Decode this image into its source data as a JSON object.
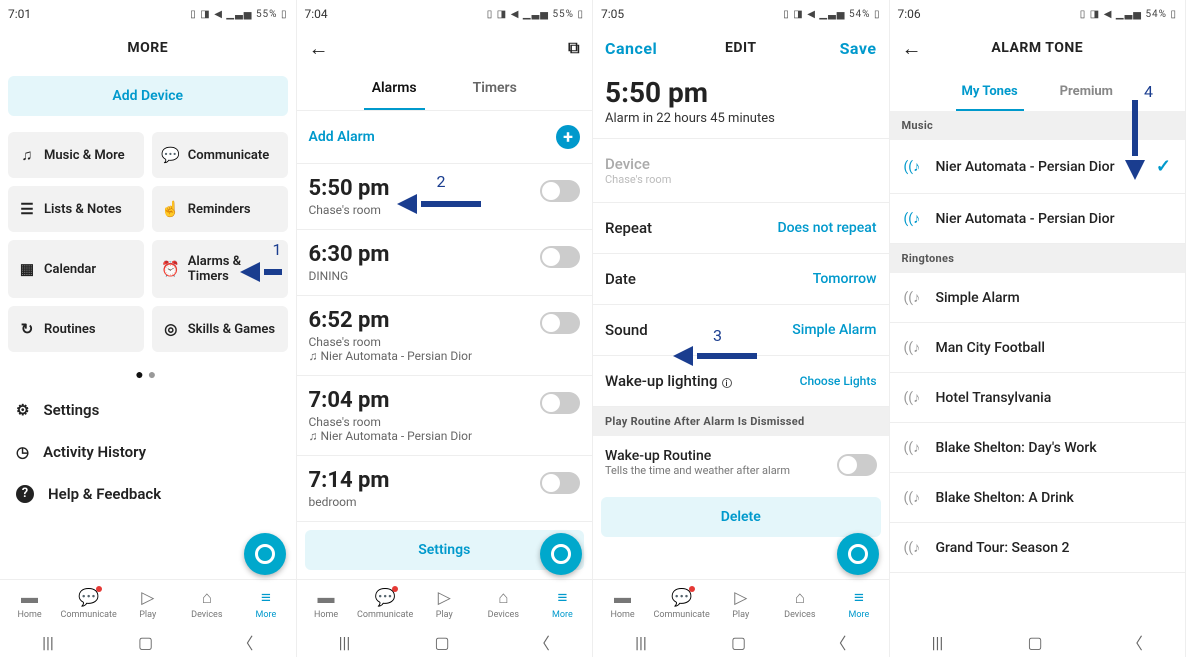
{
  "screen1": {
    "status_time": "7:01",
    "status_right": "55%",
    "title": "MORE",
    "add_device": "Add Device",
    "tiles": [
      {
        "icon": "♫",
        "label": "Music & More"
      },
      {
        "icon": "💬",
        "label": "Communicate"
      },
      {
        "icon": "☰",
        "label": "Lists & Notes"
      },
      {
        "icon": "☝",
        "label": "Reminders"
      },
      {
        "icon": "▦",
        "label": "Calendar"
      },
      {
        "icon": "⏰",
        "label": "Alarms & Timers"
      },
      {
        "icon": "↻",
        "label": "Routines"
      },
      {
        "icon": "◎",
        "label": "Skills & Games"
      }
    ],
    "rows": [
      {
        "icon": "⚙",
        "label": "Settings"
      },
      {
        "icon": "◷",
        "label": "Activity History"
      },
      {
        "icon": "?",
        "label": "Help & Feedback"
      }
    ]
  },
  "screen2": {
    "status_time": "7:04",
    "status_right": "55%",
    "tabs": {
      "alarms": "Alarms",
      "timers": "Timers"
    },
    "add_alarm": "Add Alarm",
    "alarms": [
      {
        "time": "5:50 pm",
        "room": "Chase's room",
        "music": null
      },
      {
        "time": "6:30 pm",
        "room": "DINING",
        "music": null
      },
      {
        "time": "6:52 pm",
        "room": "Chase's room",
        "music": "Nier Automata - Persian Dior"
      },
      {
        "time": "7:04 pm",
        "room": "Chase's room",
        "music": "Nier Automata - Persian Dior"
      },
      {
        "time": "7:14 pm",
        "room": "bedroom",
        "music": null
      }
    ],
    "settings": "Settings"
  },
  "screen3": {
    "status_time": "7:05",
    "status_right": "54%",
    "cancel": "Cancel",
    "title": "EDIT",
    "save": "Save",
    "bigtime": "5:50 pm",
    "alarmin": "Alarm in 22 hours 45 minutes",
    "device_label": "Device",
    "device_value": "Chase's room",
    "repeat_label": "Repeat",
    "repeat_value": "Does not repeat",
    "date_label": "Date",
    "date_value": "Tomorrow",
    "sound_label": "Sound",
    "sound_value": "Simple Alarm",
    "wake_label": "Wake-up lighting",
    "wake_value": "Choose Lights",
    "section": "Play Routine After Alarm Is Dismissed",
    "routine_t1": "Wake-up Routine",
    "routine_t2": "Tells the time and weather after alarm",
    "delete": "Delete"
  },
  "screen4": {
    "status_time": "7:06",
    "status_right": "54%",
    "title": "ALARM TONE",
    "tabs": {
      "my": "My Tones",
      "premium": "Premium"
    },
    "section_music": "Music",
    "music_items": [
      {
        "name": "Nier Automata - Persian Dior",
        "selected": true
      },
      {
        "name": "Nier Automata - Persian Dior",
        "selected": false
      }
    ],
    "section_ring": "Ringtones",
    "ringtones": [
      "Simple Alarm",
      "Man City Football",
      "Hotel Transylvania",
      "Blake Shelton: Day's Work",
      "Blake Shelton: A Drink",
      "Grand Tour: Season 2"
    ]
  },
  "nav": {
    "home": "Home",
    "communicate": "Communicate",
    "play": "Play",
    "devices": "Devices",
    "more": "More"
  },
  "annotations": {
    "n1": "1",
    "n2": "2",
    "n3": "3",
    "n4": "4"
  }
}
